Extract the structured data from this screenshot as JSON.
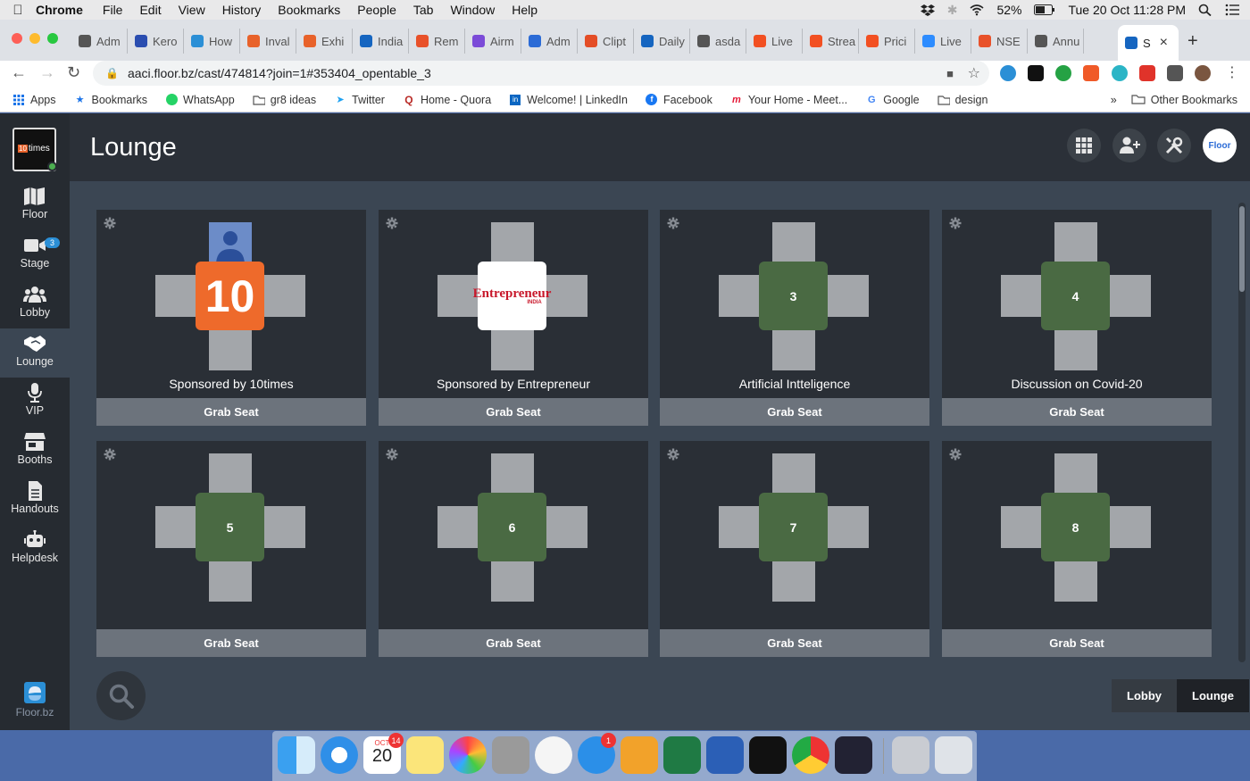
{
  "menubar": {
    "app_name": "Chrome",
    "items": [
      "File",
      "Edit",
      "View",
      "History",
      "Bookmarks",
      "People",
      "Tab",
      "Window",
      "Help"
    ],
    "battery": "52%",
    "clock": "Tue 20 Oct  11:28 PM"
  },
  "tabs": [
    {
      "title": "Adm",
      "color": "#555"
    },
    {
      "title": "Kero",
      "color": "#2a4db0"
    },
    {
      "title": "How",
      "color": "#2b8fd6"
    },
    {
      "title": "Inval",
      "color": "#e8622a"
    },
    {
      "title": "Exhi",
      "color": "#e8622a"
    },
    {
      "title": "India",
      "color": "#1565c0"
    },
    {
      "title": "Rem",
      "color": "#e8512a"
    },
    {
      "title": "Airm",
      "color": "#7b4bd8"
    },
    {
      "title": "Adm",
      "color": "#2b6bd6"
    },
    {
      "title": "Clipt",
      "color": "#e44d26"
    },
    {
      "title": "Daily",
      "color": "#1565c0"
    },
    {
      "title": "asda",
      "color": "#555"
    },
    {
      "title": "Live",
      "color": "#f25022"
    },
    {
      "title": "Strea",
      "color": "#f25022"
    },
    {
      "title": "Prici",
      "color": "#f25022"
    },
    {
      "title": "Live",
      "color": "#2d8cff"
    },
    {
      "title": "NSE",
      "color": "#e8512a"
    },
    {
      "title": "Annu",
      "color": "#555"
    }
  ],
  "active_tab": {
    "title": "S"
  },
  "address_bar": {
    "url": "aaci.floor.bz/cast/474814?join=1#353404_opentable_3"
  },
  "bookmarks": [
    {
      "label": "Apps",
      "icon": "apps-grid-icon"
    },
    {
      "label": "Bookmarks",
      "icon": "star-icon"
    },
    {
      "label": "WhatsApp",
      "icon": "whatsapp-icon"
    },
    {
      "label": "gr8 ideas",
      "icon": "folder-icon"
    },
    {
      "label": "Twitter",
      "icon": "twitter-icon"
    },
    {
      "label": "Home - Quora",
      "icon": "quora-icon"
    },
    {
      "label": "Welcome! | LinkedIn",
      "icon": "linkedin-icon"
    },
    {
      "label": "Facebook",
      "icon": "facebook-icon"
    },
    {
      "label": "Your Home - Meet...",
      "icon": "meetup-icon"
    },
    {
      "label": "Google",
      "icon": "google-icon"
    },
    {
      "label": "design",
      "icon": "folder-icon"
    }
  ],
  "bookmarks_overflow": "»",
  "other_bookmarks": "Other Bookmarks",
  "sidebar": {
    "org_logo_text": "times",
    "org_logo_num": "10",
    "items": [
      {
        "label": "Floor",
        "icon": "map-icon"
      },
      {
        "label": "Stage",
        "icon": "video-camera-icon",
        "badge": "3"
      },
      {
        "label": "Lobby",
        "icon": "people-group-icon"
      },
      {
        "label": "Lounge",
        "icon": "handshake-icon",
        "active": true
      },
      {
        "label": "VIP",
        "icon": "microphone-icon"
      },
      {
        "label": "Booths",
        "icon": "store-icon"
      },
      {
        "label": "Handouts",
        "icon": "document-icon"
      },
      {
        "label": "Helpdesk",
        "icon": "robot-icon"
      }
    ],
    "brand": "Floor.bz"
  },
  "header": {
    "title": "Lounge",
    "actions": [
      "grid-icon",
      "add-user-icon",
      "tools-icon",
      "floor-logo"
    ],
    "logo_text": "Floor"
  },
  "tables": [
    {
      "number": "10",
      "name": "Sponsored by 10times",
      "style": "orange",
      "occupied": true
    },
    {
      "number": "Entrepreneur",
      "sub": "INDIA",
      "name": "Sponsored by Entrepreneur",
      "style": "white"
    },
    {
      "number": "3",
      "name": "Artificial Intteligence",
      "style": "green"
    },
    {
      "number": "4",
      "name": "Discussion on Covid-20",
      "style": "green"
    },
    {
      "number": "5",
      "name": "",
      "style": "green"
    },
    {
      "number": "6",
      "name": "",
      "style": "green"
    },
    {
      "number": "7",
      "name": "",
      "style": "green"
    },
    {
      "number": "8",
      "name": "",
      "style": "green"
    }
  ],
  "grab_seat_label": "Grab Seat",
  "room_switcher": [
    {
      "label": "Lobby",
      "active": false
    },
    {
      "label": "Lounge",
      "active": true
    }
  ],
  "dock": {
    "calendar_month": "OCT",
    "calendar_day": "20",
    "calendar_badge": "14",
    "appstore_badge": "1"
  }
}
